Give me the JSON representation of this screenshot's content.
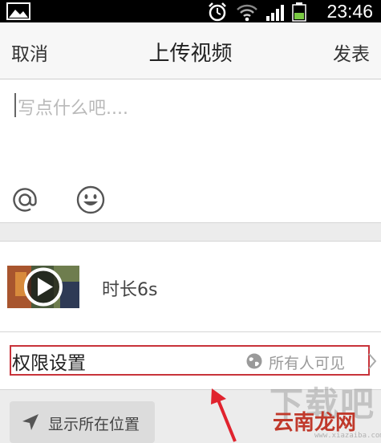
{
  "status_bar": {
    "time": "23:46",
    "icons": [
      "gallery-notification-icon",
      "alarm-icon",
      "wifi-icon",
      "signal-icon",
      "battery-icon"
    ]
  },
  "nav": {
    "cancel_label": "取消",
    "title": "上传视频",
    "post_label": "发表"
  },
  "compose": {
    "placeholder": "写点什么吧....",
    "toolbar_icons": [
      "at-icon",
      "emoji-icon"
    ]
  },
  "video": {
    "duration_label": "时长6s",
    "thumbnail_icon": "play-icon"
  },
  "permission": {
    "label": "权限设置",
    "icon": "globe-icon",
    "value": "所有人可见"
  },
  "location": {
    "label": "显示所在位置",
    "icon": "location-arrow-icon"
  },
  "watermark": {
    "big": "下载吧",
    "site": "云南龙网",
    "url": "www.xiazaiba.com"
  },
  "colors": {
    "highlight_box": "#c8333a",
    "annotation_arrow": "#e0232e",
    "background_gray": "#ececec"
  }
}
